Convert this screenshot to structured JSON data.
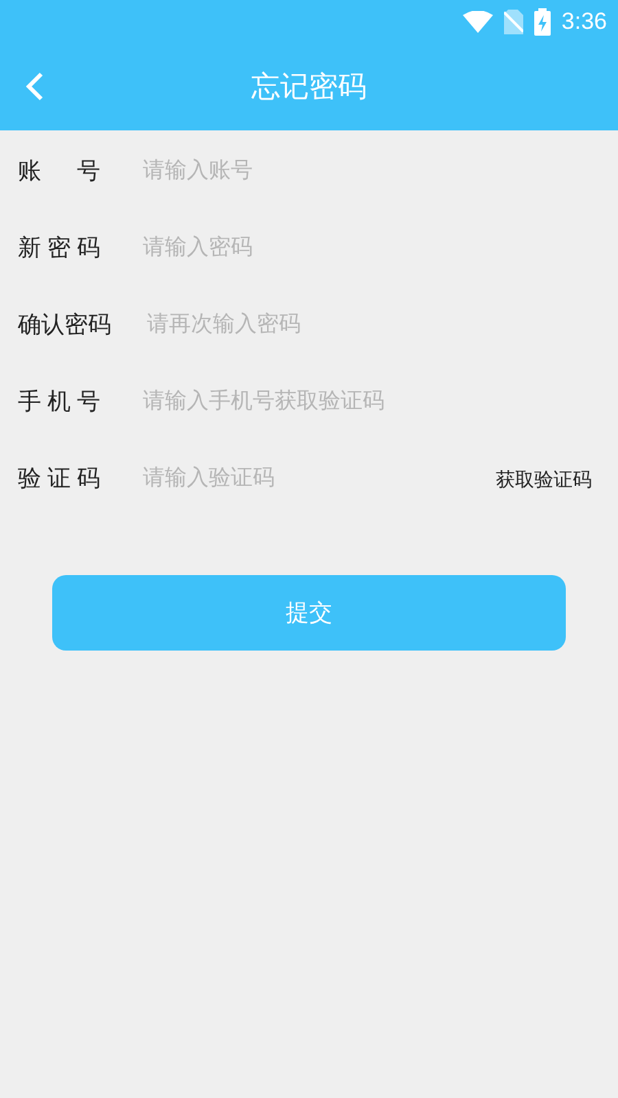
{
  "status_bar": {
    "time": "3:36"
  },
  "header": {
    "title": "忘记密码"
  },
  "fields": [
    {
      "label": "账号",
      "placeholder": "请输入账号"
    },
    {
      "label": "新密码",
      "placeholder": "请输入密码"
    },
    {
      "label": "确认密码",
      "placeholder": "请再次输入密码"
    },
    {
      "label": "手机号",
      "placeholder": "请输入手机号获取验证码"
    },
    {
      "label": "验证码",
      "placeholder": "请输入验证码",
      "action": "获取验证码"
    }
  ],
  "submit": "提交"
}
